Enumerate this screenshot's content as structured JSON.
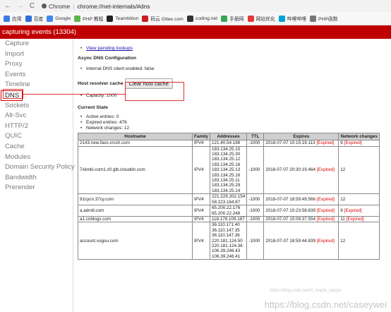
{
  "browser": {
    "back": "←",
    "forward": "→",
    "reload": "C",
    "secure_label": "Chrome",
    "separator": "|",
    "url": "chrome://net-internals/#dns"
  },
  "bookmarks": [
    {
      "label": "应用",
      "color": "#3b7de0"
    },
    {
      "label": "百度",
      "color": "#2f6fd6"
    },
    {
      "label": "Google",
      "color": "#4285f4"
    },
    {
      "label": "PHP 教程",
      "color": "#5bb548"
    },
    {
      "label": "Teambition",
      "color": "#222222"
    },
    {
      "label": "码云 Gitee.com",
      "color": "#c71d23"
    },
    {
      "label": "coding.net",
      "color": "#333333"
    },
    {
      "label": "手册网",
      "color": "#34a853"
    },
    {
      "label": "网站优化",
      "color": "#e53935"
    },
    {
      "label": "哔哩哔哩",
      "color": "#00a1d6"
    },
    {
      "label": "PHP函数",
      "color": "#777777"
    }
  ],
  "header": {
    "title": "capturing events (13304)"
  },
  "sidebar": {
    "items": [
      "Capture",
      "Import",
      "Proxy",
      "Events",
      "Timeline",
      "DNS",
      "Sockets",
      "Alt-Svc",
      "HTTP/2",
      "QUIC",
      "Cache",
      "Modules",
      "Domain Security Policy",
      "Bandwidth",
      "Prerender"
    ],
    "active": "DNS"
  },
  "main": {
    "pending_link": "View pending lookups",
    "async_title": "Async DNS Configuration",
    "async_info": "Internal DNS client enabled: false",
    "resolver_title": "Host resolver cache",
    "clear_button": "Clear host cache",
    "capacity": "Capacity: 1000",
    "current_state_title": "Current State",
    "state": [
      "Active entries: 0",
      "Expired entries: 476",
      "Network changes: 12"
    ]
  },
  "table": {
    "headers": [
      "Hostname",
      "Family",
      "Addresses",
      "TTL",
      "Expires",
      "Network changes"
    ],
    "rows": [
      {
        "host": "2143.new.favo.xrcch.com",
        "family": "IPV4",
        "addresses": [
          "121.40.54.198"
        ],
        "ttl": "-1000",
        "expires": "2018-07-07 10:15:19.113",
        "expired": "[Expired]",
        "net": "9",
        "net_expired": "[Expired]"
      },
      {
        "host": "7xkmkl.com1.z0.glb.clouddn.com",
        "family": "IPV4",
        "addresses": [
          "183.134.25.15",
          "183.134.25.30",
          "183.134.25.12",
          "183.134.25.16",
          "183.134.25.13",
          "183.134.25.16",
          "183.134.25.11",
          "183.134.25.29",
          "183.134.25.14"
        ],
        "ttl": "-1000",
        "expires": "2018-07-07 20:30:19.464",
        "expired": "[Expired]",
        "net": "12",
        "net_expired": ""
      },
      {
        "host": "91cycn.37cy.com",
        "family": "IPV4",
        "addresses": [
          "221.229.202.154",
          "58.223.164.87"
        ],
        "ttl": "-1000",
        "expires": "2018-07-07 18:59:49.566",
        "expired": "[Expired]",
        "net": "12",
        "net_expired": ""
      },
      {
        "host": "a.adroll.com",
        "family": "IPV4",
        "addresses": [
          "65.200.22.176",
          "65.200.22.248"
        ],
        "ttl": "-1000",
        "expires": "2018-07-07 10:23:58.839",
        "expired": "[Expired]",
        "net": "9",
        "net_expired": "[Expired]"
      },
      {
        "host": "a1.cnblogs.com",
        "family": "IPV4",
        "addresses": [
          "118.178.109.187"
        ],
        "ttl": "-1000",
        "expires": "2018-07-07 15:09:37.554",
        "expired": "[Expired]",
        "net": "11",
        "net_expired": "[Expired]"
      },
      {
        "host": "account.sogou.com",
        "family": "IPV4",
        "addresses": [
          "36.110.171.40",
          "36.110.147.35",
          "36.110.147.36",
          "220.181.124.50",
          "220.181.124.36",
          "106.39.246.43",
          "106.39.246.41"
        ],
        "ttl": "-1000",
        "expires": "2018-07-07 18:59:44.839",
        "expired": "[Expired]",
        "net": "12",
        "net_expired": ""
      }
    ]
  },
  "watermark": {
    "main": "https://blog.csdn.net/caseywei",
    "faint": "https://blog.csdn.net/m_maple_xiaoyu"
  }
}
